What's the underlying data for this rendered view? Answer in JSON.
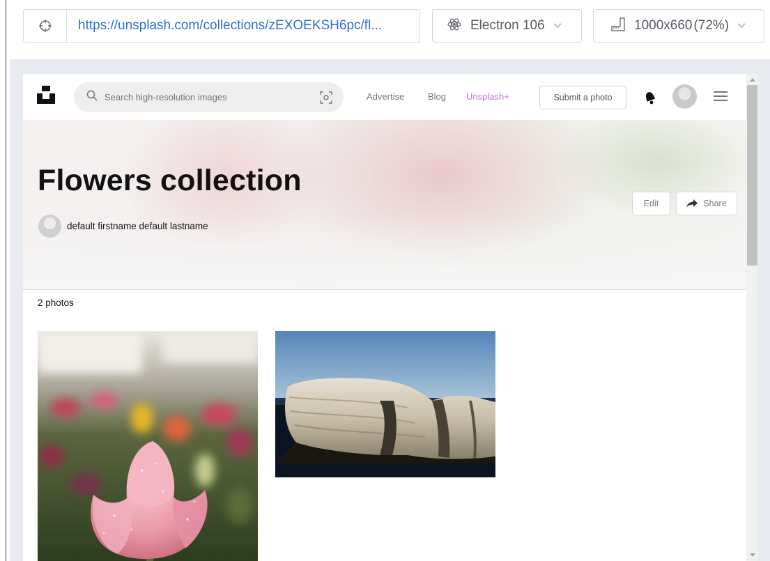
{
  "toolbar": {
    "url": "https://unsplash.com/collections/zEXOEKSH6pc/fl...",
    "engine_label": "Electron 106",
    "viewport_size": "1000x660",
    "zoom": "(72%)",
    "icons": [
      "crosshair-icon",
      "electron-icon",
      "ruler-icon",
      "chevron-down-icon"
    ]
  },
  "nav": {
    "search_placeholder": "Search high-resolution images",
    "links": {
      "advertise": "Advertise",
      "blog": "Blog",
      "plus": "Unsplash+"
    },
    "submit_label": "Submit a photo",
    "accent_color": "#c06fd1"
  },
  "hero": {
    "title": "Flowers collection",
    "owner_name": "default firstname default lastname",
    "edit_label": "Edit",
    "share_label": "Share"
  },
  "collection": {
    "photo_count_text": "2 photos",
    "photos": [
      "tulip-photo",
      "rock-photo"
    ]
  }
}
